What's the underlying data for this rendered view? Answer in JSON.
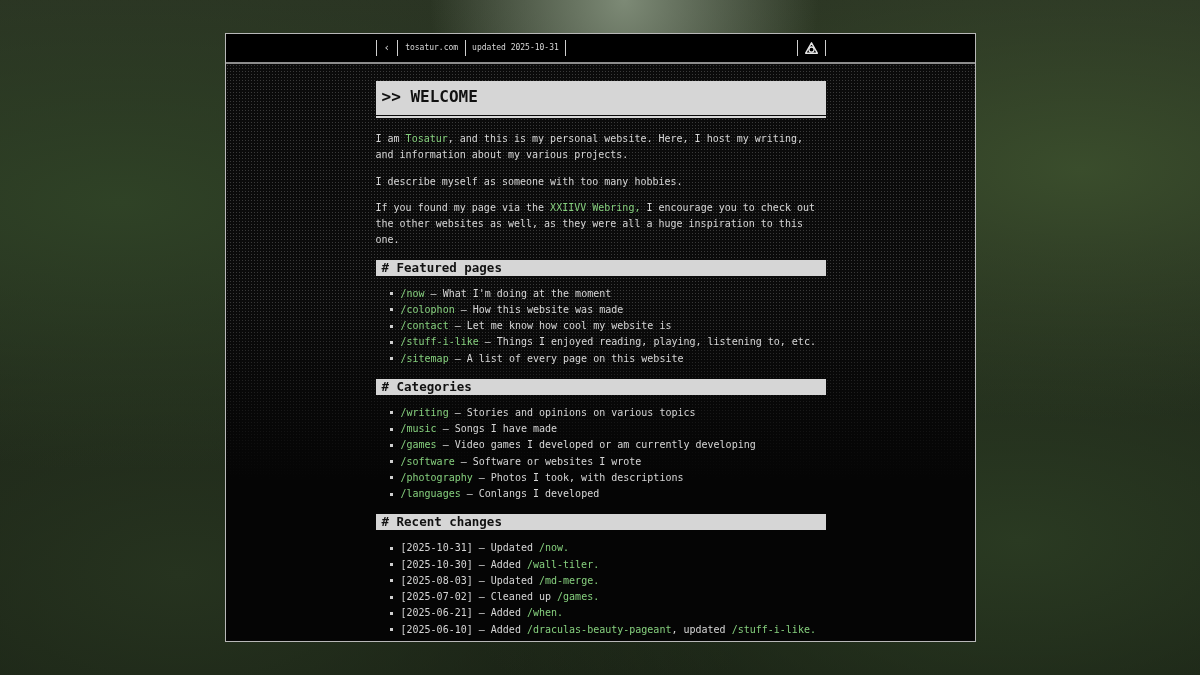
{
  "header": {
    "back": "‹",
    "site": "tosatur.com",
    "updated": "updated 2025-10-31"
  },
  "title": ">> WELCOME",
  "intro": [
    {
      "segments": [
        {
          "kind": "text",
          "text": "I am "
        },
        {
          "kind": "link",
          "text": "Tosatur"
        },
        {
          "kind": "text",
          "text": ", and this is my personal website. Here, I host my writing, and information about my various projects."
        }
      ]
    },
    {
      "segments": [
        {
          "kind": "text",
          "text": "I describe myself as someone with too many hobbies."
        }
      ]
    },
    {
      "segments": [
        {
          "kind": "text",
          "text": "If you found my page via the "
        },
        {
          "kind": "link",
          "text": "XXIIVV Webring,"
        },
        {
          "kind": "text",
          "text": " I encourage you to check out the other websites as well, as they were all a huge inspiration to this one."
        }
      ]
    }
  ],
  "sections": [
    {
      "heading": "# Featured pages",
      "items": [
        {
          "segments": [
            {
              "kind": "link",
              "text": "/now"
            },
            {
              "kind": "text",
              "text": " — What I'm doing at the moment"
            }
          ]
        },
        {
          "segments": [
            {
              "kind": "link",
              "text": "/colophon"
            },
            {
              "kind": "text",
              "text": " — How this website was made"
            }
          ]
        },
        {
          "segments": [
            {
              "kind": "link",
              "text": "/contact"
            },
            {
              "kind": "text",
              "text": " — Let me know how cool my website is"
            }
          ]
        },
        {
          "segments": [
            {
              "kind": "link",
              "text": "/stuff-i-like"
            },
            {
              "kind": "text",
              "text": " — Things I enjoyed reading, playing, listening to, etc."
            }
          ]
        },
        {
          "segments": [
            {
              "kind": "link",
              "text": "/sitemap"
            },
            {
              "kind": "text",
              "text": " — A list of every page on this website"
            }
          ]
        }
      ]
    },
    {
      "heading": "# Categories",
      "items": [
        {
          "segments": [
            {
              "kind": "link",
              "text": "/writing"
            },
            {
              "kind": "text",
              "text": " — Stories and opinions on various topics"
            }
          ]
        },
        {
          "segments": [
            {
              "kind": "link",
              "text": "/music"
            },
            {
              "kind": "text",
              "text": " — Songs I have made"
            }
          ]
        },
        {
          "segments": [
            {
              "kind": "link",
              "text": "/games"
            },
            {
              "kind": "text",
              "text": " — Video games I developed or am currently developing"
            }
          ]
        },
        {
          "segments": [
            {
              "kind": "link",
              "text": "/software"
            },
            {
              "kind": "text",
              "text": " — Software or websites I wrote"
            }
          ]
        },
        {
          "segments": [
            {
              "kind": "link",
              "text": "/photography"
            },
            {
              "kind": "text",
              "text": " — Photos I took, with descriptions"
            }
          ]
        },
        {
          "segments": [
            {
              "kind": "link",
              "text": "/languages"
            },
            {
              "kind": "text",
              "text": " — Conlangs I developed"
            }
          ]
        }
      ]
    },
    {
      "heading": "# Recent changes",
      "items": [
        {
          "segments": [
            {
              "kind": "text",
              "text": "[2025-10-31] — Updated "
            },
            {
              "kind": "link",
              "text": "/now."
            }
          ]
        },
        {
          "segments": [
            {
              "kind": "text",
              "text": "[2025-10-30] — Added "
            },
            {
              "kind": "link",
              "text": "/wall-tiler."
            }
          ]
        },
        {
          "segments": [
            {
              "kind": "text",
              "text": "[2025-08-03] — Updated "
            },
            {
              "kind": "link",
              "text": "/md-merge."
            }
          ]
        },
        {
          "segments": [
            {
              "kind": "text",
              "text": "[2025-07-02] — Cleaned up "
            },
            {
              "kind": "link",
              "text": "/games."
            }
          ]
        },
        {
          "segments": [
            {
              "kind": "text",
              "text": "[2025-06-21] — Added "
            },
            {
              "kind": "link",
              "text": "/when."
            }
          ]
        },
        {
          "segments": [
            {
              "kind": "text",
              "text": "[2025-06-10] — Added "
            },
            {
              "kind": "link",
              "text": "/draculas-beauty-pageant"
            },
            {
              "kind": "text",
              "text": ", updated "
            },
            {
              "kind": "link",
              "text": "/stuff-i-like."
            }
          ]
        }
      ]
    }
  ]
}
